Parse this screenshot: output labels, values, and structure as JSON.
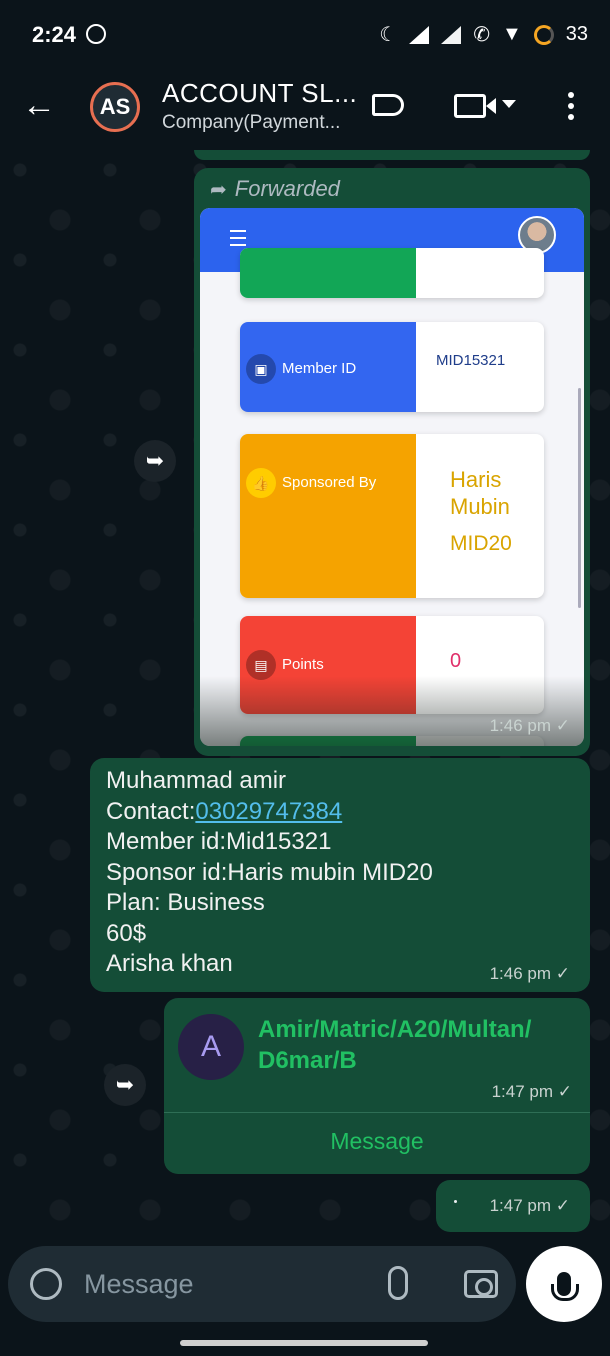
{
  "status_bar": {
    "time": "2:24",
    "battery": "33",
    "icons": [
      "whatsapp-status-icon",
      "do-not-disturb-moon-icon",
      "signal-icon",
      "signal-icon",
      "wifi-calling-icon",
      "wifi-icon",
      "battery-ring-icon"
    ]
  },
  "header": {
    "avatar_initials": "AS",
    "title": "ACCOUNT SL...",
    "subtitle": "Company(Payment...",
    "icons": [
      "back-arrow-icon",
      "label-icon",
      "video-call-icon",
      "caret-down-icon",
      "more-vert-icon"
    ]
  },
  "messages": {
    "forwarded_image": {
      "forwarded_label": "Forwarded",
      "time": "1:46 pm",
      "tick": "✓",
      "screenshot": {
        "cards": [
          {
            "label": "Member ID",
            "value": "MID15321",
            "color": "#3366f0"
          },
          {
            "label": "Sponsored By",
            "value": "Haris Mubin MID20",
            "value_line1": "Haris",
            "value_line2": "Mubin",
            "value_line3": "MID20",
            "color": "#f5a300"
          },
          {
            "label": "Points",
            "value": "0",
            "color": "#f44336"
          }
        ]
      }
    },
    "text_message": {
      "line1": "Muhammad amir",
      "contact_label": "Contact:",
      "contact_number": "03029747384",
      "line3": "Member id:Mid15321",
      "line4": "Sponsor id:Haris mubin MID20",
      "line5": "Plan: Business",
      "line6": "60$",
      "line7": "Arisha khan",
      "time": "1:46 pm",
      "tick": "✓"
    },
    "contact_card": {
      "avatar_letter": "A",
      "name": "Amir/Matric/A20/Multan/D6mar/B",
      "name_line1": "Amir/Matric/A20/Multan/",
      "name_line2": "D6mar/B",
      "time": "1:47 pm",
      "tick": "✓",
      "action": "Message"
    },
    "small_message": {
      "time": "1:47 pm",
      "tick": "✓"
    }
  },
  "composer": {
    "placeholder": "Message"
  },
  "colors": {
    "bubble_outgoing": "#144d37",
    "accent_green": "#21c063",
    "link_blue": "#53bdeb",
    "background": "#0b141a"
  }
}
